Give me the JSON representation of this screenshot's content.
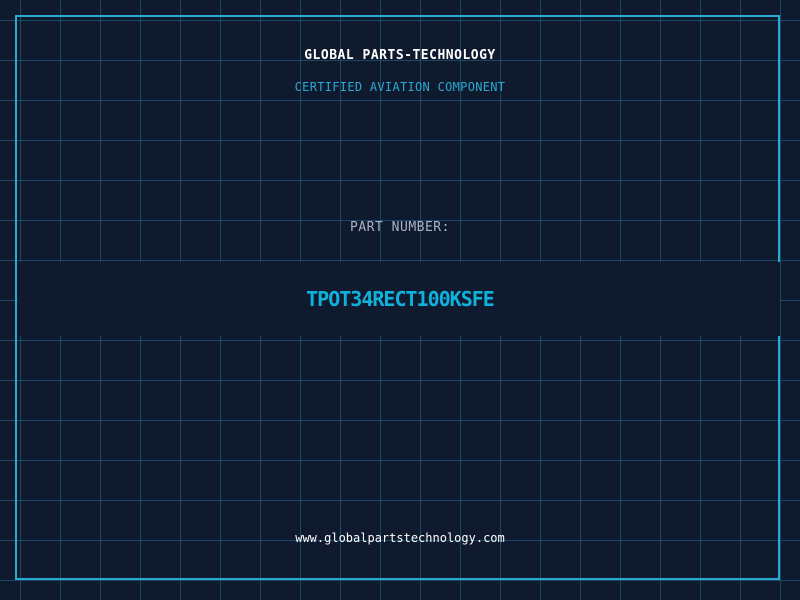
{
  "header": {
    "company": "GLOBAL PARTS-TECHNOLOGY",
    "subtitle": "CERTIFIED AVIATION COMPONENT"
  },
  "part": {
    "label": "PART NUMBER:",
    "number": "TPOT34RECT100KSFE"
  },
  "footer": {
    "website": "www.globalpartstechnology.com"
  },
  "colors": {
    "background": "#101a2e",
    "grid": "#1f6c8c",
    "accent": "#0fb2dd",
    "frame": "#2aa9d2",
    "text": "#ffffff",
    "muted": "#a9b3c6"
  }
}
